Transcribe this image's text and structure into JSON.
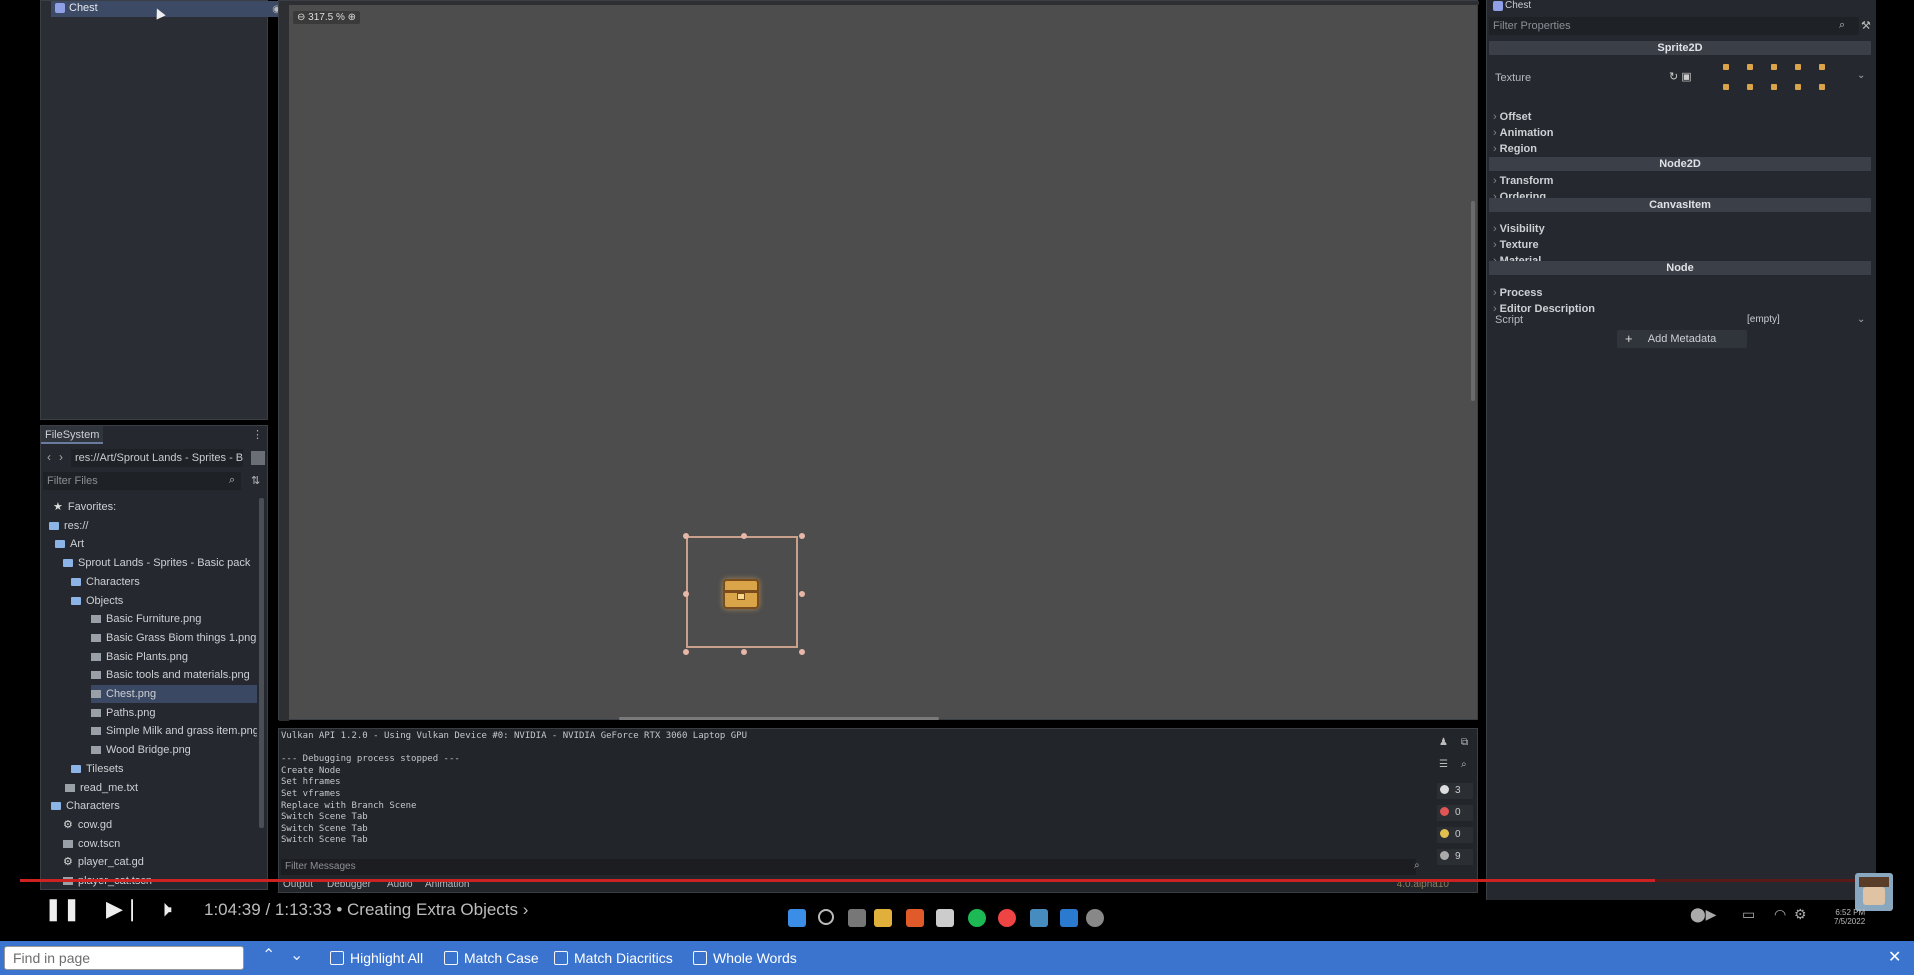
{
  "scene_dock": {
    "selected_node": "Chest"
  },
  "filesystem": {
    "tab_label": "FileSystem",
    "path": "res://Art/Sprout Lands - Sprites - B",
    "filter_placeholder": "Filter Files",
    "items": [
      {
        "label": "Favorites:",
        "icon": "star-icon"
      },
      {
        "label": "res://",
        "icon": "folder-icon"
      },
      {
        "label": "Art",
        "icon": "folder-icon"
      },
      {
        "label": "Sprout Lands - Sprites - Basic pack",
        "icon": "folder-icon"
      },
      {
        "label": "Characters",
        "icon": "folder-icon"
      },
      {
        "label": "Objects",
        "icon": "folder-icon"
      },
      {
        "label": "Basic Furniture.png",
        "icon": "image-file-icon"
      },
      {
        "label": "Basic Grass Biom things 1.png",
        "icon": "image-file-icon"
      },
      {
        "label": "Basic Plants.png",
        "icon": "image-file-icon"
      },
      {
        "label": "Basic tools and materials.png",
        "icon": "image-file-icon"
      },
      {
        "label": "Chest.png",
        "icon": "image-file-icon"
      },
      {
        "label": "Paths.png",
        "icon": "image-file-icon"
      },
      {
        "label": "Simple Milk and grass item.png",
        "icon": "image-file-icon"
      },
      {
        "label": "Wood Bridge.png",
        "icon": "image-file-icon"
      },
      {
        "label": "Tilesets",
        "icon": "folder-icon"
      },
      {
        "label": "read_me.txt",
        "icon": "text-file-icon"
      },
      {
        "label": "Characters",
        "icon": "folder-icon"
      },
      {
        "label": "cow.gd",
        "icon": "script-file-icon"
      },
      {
        "label": "cow.tscn",
        "icon": "scene-file-icon"
      },
      {
        "label": "player_cat.gd",
        "icon": "script-file-icon"
      },
      {
        "label": "player_cat.tscn",
        "icon": "scene-file-icon"
      }
    ],
    "selected_index": 10
  },
  "viewport": {
    "zoom": "317.5 %"
  },
  "output": {
    "lines": [
      "Vulkan API 1.2.0 - Using Vulkan Device #0: NVIDIA - NVIDIA GeForce RTX 3060 Laptop GPU",
      "",
      "--- Debugging process stopped ---",
      "Create Node",
      "Set hframes",
      "Set vframes",
      "Replace with Branch Scene",
      "Switch Scene Tab",
      "Switch Scene Tab",
      "Switch Scene Tab"
    ],
    "filter_placeholder": "Filter Messages",
    "counters": {
      "errors_label": "3",
      "error_count": "0",
      "warning_count": "0",
      "info_count": "9"
    },
    "tabs": [
      "Output",
      "Debugger",
      "Audio",
      "Animation"
    ],
    "version": "4.0.alpha10"
  },
  "inspector": {
    "node_name": "Chest",
    "filter_placeholder": "Filter Properties",
    "sections": {
      "sprite2d": "Sprite2D",
      "node2d": "Node2D",
      "canvasitem": "CanvasItem",
      "node": "Node"
    },
    "texture_label": "Texture",
    "sprite_props": [
      "Offset",
      "Animation",
      "Region"
    ],
    "node2d_props": [
      "Transform",
      "Ordering"
    ],
    "canvas_props": [
      "Visibility",
      "Texture",
      "Material"
    ],
    "node_props": [
      "Process",
      "Editor Description"
    ],
    "script_label": "Script",
    "script_value": "[empty]",
    "add_metadata": "Add Metadata"
  },
  "video": {
    "time": "1:04:39 / 1:13:33 • Creating Extra Objects ›",
    "progress": 0.879
  },
  "clock": {
    "time": "6:52 PM",
    "date": "7/5/2022"
  },
  "findbar": {
    "placeholder": "Find in page",
    "options": [
      "Highlight All",
      "Match Case",
      "Match Diacritics",
      "Whole Words"
    ]
  },
  "colors": {
    "find_bar": "#3b74ce",
    "selection": "#3b4863",
    "viewport": "#4d4d4d",
    "progress": "#cc2222"
  }
}
